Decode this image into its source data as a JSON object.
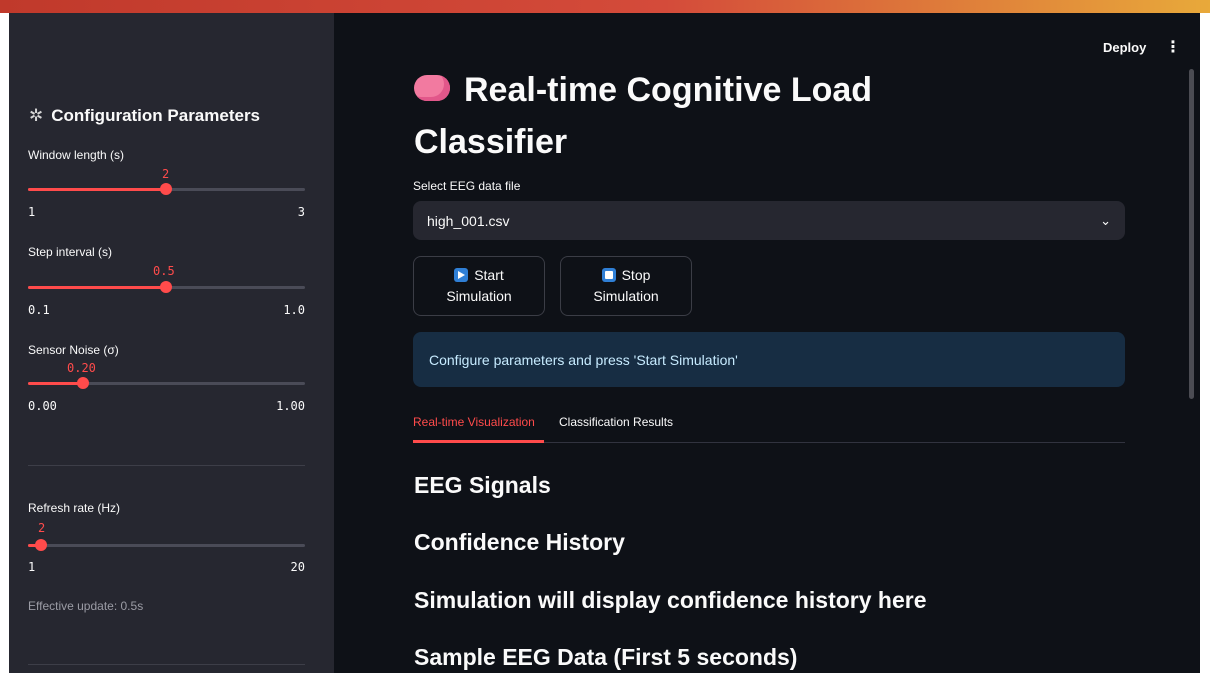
{
  "sidebar": {
    "title": "Configuration Parameters",
    "icon": "gear-icon",
    "window_length": {
      "label": "Window length (s)",
      "value": "2",
      "min": "1",
      "max": "3",
      "fraction": 0.5
    },
    "step_interval": {
      "label": "Step interval (s)",
      "value": "0.5",
      "min": "0.1",
      "max": "1.0",
      "fraction": 0.5
    },
    "sensor_noise": {
      "label": "Sensor Noise (σ)",
      "value": "0.20",
      "min": "0.00",
      "max": "1.00",
      "fraction": 0.2
    },
    "refresh_rate": {
      "label": "Refresh rate (Hz)",
      "value": "2",
      "min": "1",
      "max": "20",
      "fraction": 0.05
    },
    "effective_update": "Effective update: 0.5s"
  },
  "header": {
    "deploy_label": "Deploy",
    "menu_glyph": "⋮"
  },
  "main": {
    "title": "Real-time Cognitive Load Classifier",
    "file_select": {
      "label": "Select EEG data file",
      "value": "high_001.csv"
    },
    "start_button": {
      "line1": "Start",
      "line2": "Simulation"
    },
    "stop_button": {
      "line1": "Stop",
      "line2": "Simulation"
    },
    "info_message": "Configure parameters and press 'Start Simulation'",
    "tabs": [
      {
        "label": "Real-time Visualization",
        "active": true
      },
      {
        "label": "Classification Results",
        "active": false
      }
    ],
    "sections": [
      "EEG Signals",
      "Confidence History",
      "Simulation will display confidence history here",
      "Sample EEG Data (First 5 seconds)"
    ]
  },
  "colors": {
    "accent": "#ff4b4b",
    "sidebar_bg": "#262730",
    "main_bg": "#0e1117",
    "info_bg": "#172d43",
    "info_text": "#c7ebff"
  }
}
